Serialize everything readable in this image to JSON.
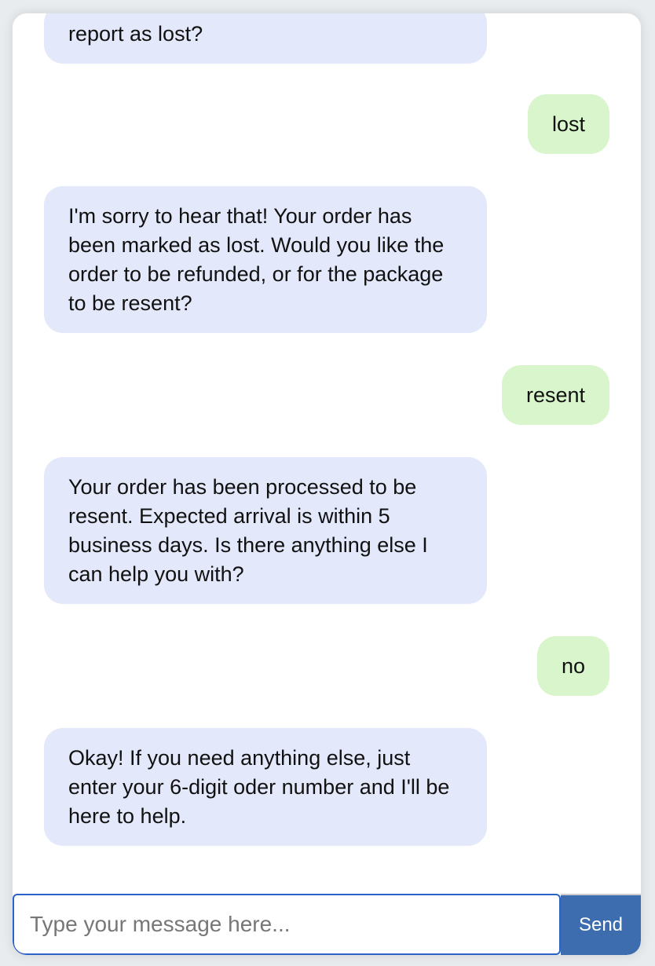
{
  "messages": [
    {
      "sender": "bot",
      "text": "report as lost?"
    },
    {
      "sender": "user",
      "text": "lost"
    },
    {
      "sender": "bot",
      "text": "I'm sorry to hear that! Your order has been marked as lost. Would you like the order to be refunded, or for the package to be resent?"
    },
    {
      "sender": "user",
      "text": "resent"
    },
    {
      "sender": "bot",
      "text": "Your order has been processed to be resent. Expected arrival is within 5 business days. Is there anything else I can help you with?"
    },
    {
      "sender": "user",
      "text": "no"
    },
    {
      "sender": "bot",
      "text": "Okay! If you need anything else, just enter your 6-digit oder number and I'll be here to help."
    }
  ],
  "input": {
    "placeholder": "Type your message here...",
    "value": ""
  },
  "send_label": "Send",
  "colors": {
    "bot_bubble": "#e3e8fa",
    "user_bubble": "#d8f5cc",
    "send_button": "#3d6dae",
    "input_border": "#2a62c9"
  }
}
